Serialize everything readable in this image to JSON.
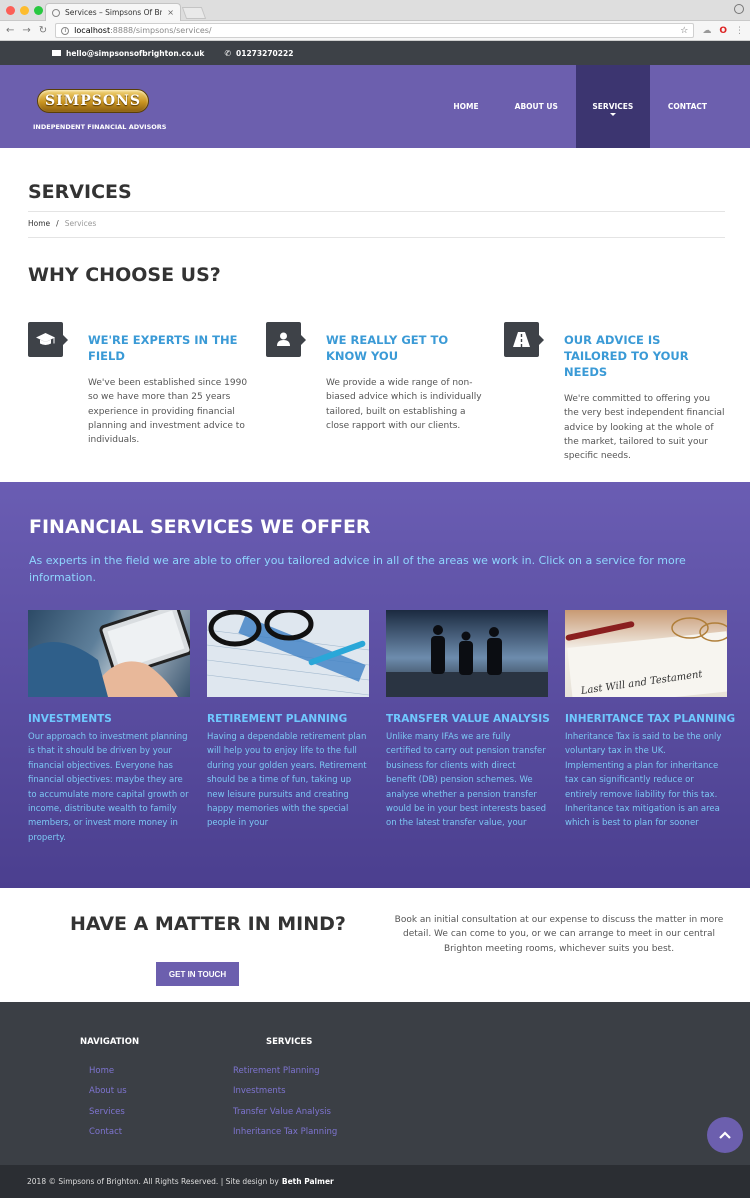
{
  "browser": {
    "tab_title": "Services – Simpsons Of Brighton",
    "tab_close": "×",
    "url_host": "localhost",
    "url_path": ":8888/simpsons/services/"
  },
  "topbar": {
    "email": "hello@simpsonsofbrighton.co.uk",
    "phone": "01273270222"
  },
  "header": {
    "logo_text": "SIMPSONS",
    "tagline": "INDEPENDENT FINANCIAL ADVISORS",
    "nav": [
      "HOME",
      "ABOUT US",
      "SERVICES",
      "CONTACT"
    ]
  },
  "page": {
    "title": "SERVICES",
    "breadcrumb_home": "Home",
    "breadcrumb_sep": "/",
    "breadcrumb_current": "Services"
  },
  "why": {
    "title": "WHY CHOOSE US?",
    "features": [
      {
        "icon": "graduation-cap-icon",
        "title": "WE'RE EXPERTS IN THE FIELD",
        "text": "We've been established since 1990 so we have more than 25 years experience in providing financial planning and investment advice to individuals."
      },
      {
        "icon": "user-icon",
        "title": "WE REALLY GET TO KNOW YOU",
        "text": "We provide a wide range of non-biased advice which is individually tailored, built on establishing a close rapport with our clients."
      },
      {
        "icon": "road-icon",
        "title": "OUR ADVICE IS TAILORED TO YOUR NEEDS",
        "text": "We're committed to offering you the very best independent financial advice by looking at the whole of the market, tailored to suit your specific needs."
      }
    ]
  },
  "financial": {
    "title": "FINANCIAL SERVICES WE OFFER",
    "intro": "As experts in the field we are able to offer you tailored advice in all of the areas we work in. Click on a service for more information.",
    "services": [
      {
        "title": "INVESTMENTS",
        "text": "Our approach to investment planning is that it should be driven by your financial objectives. Everyone has financial objectives: maybe they are to accumulate more capital growth or income, distribute wealth to family members, or invest more money in property."
      },
      {
        "title": "RETIREMENT PLANNING",
        "text": "Having a dependable retirement plan will help you to enjoy life to the full during your golden years. Retirement should be a time of fun, taking up new leisure pursuits and creating happy memories with the special people in your"
      },
      {
        "title": "TRANSFER VALUE ANALYSIS",
        "text": "Unlike many IFAs we are fully certified to carry out pension transfer business for clients with direct benefit (DB) pension schemes. We analyse whether a pension transfer would be in your best interests based on the latest transfer value, your"
      },
      {
        "title": "INHERITANCE TAX PLANNING",
        "text": "Inheritance Tax is said to be the only voluntary tax in the UK. Implementing a plan for inheritance tax can significantly reduce or entirely remove liability for this tax. Inheritance tax mitigation is an area which is best to plan for sooner"
      }
    ],
    "image_caption_4": "Last Will and Testament"
  },
  "cta": {
    "title": "HAVE A MATTER IN MIND?",
    "button": "GET IN TOUCH",
    "text": "Book an initial consultation at our expense to discuss the matter in more detail. We can come to you, or we can arrange to meet in our central Brighton meeting rooms, whichever suits you best."
  },
  "footer": {
    "nav_title": "NAVIGATION",
    "nav_links": [
      "Home",
      "About us",
      "Services",
      "Contact"
    ],
    "services_title": "SERVICES",
    "services_links": [
      "Retirement Planning",
      "Investments",
      "Transfer Value Analysis",
      "Inheritance Tax Planning"
    ],
    "copyright": "2018 © Simpsons of Brighton. All Rights Reserved.  | Site design by",
    "designer": "Beth Palmer"
  },
  "colors": {
    "brand_purple": "#6c5fae",
    "nav_active": "#3c3570",
    "heading_blue": "#3a9ad6",
    "footer_bg": "#3b3f45"
  }
}
